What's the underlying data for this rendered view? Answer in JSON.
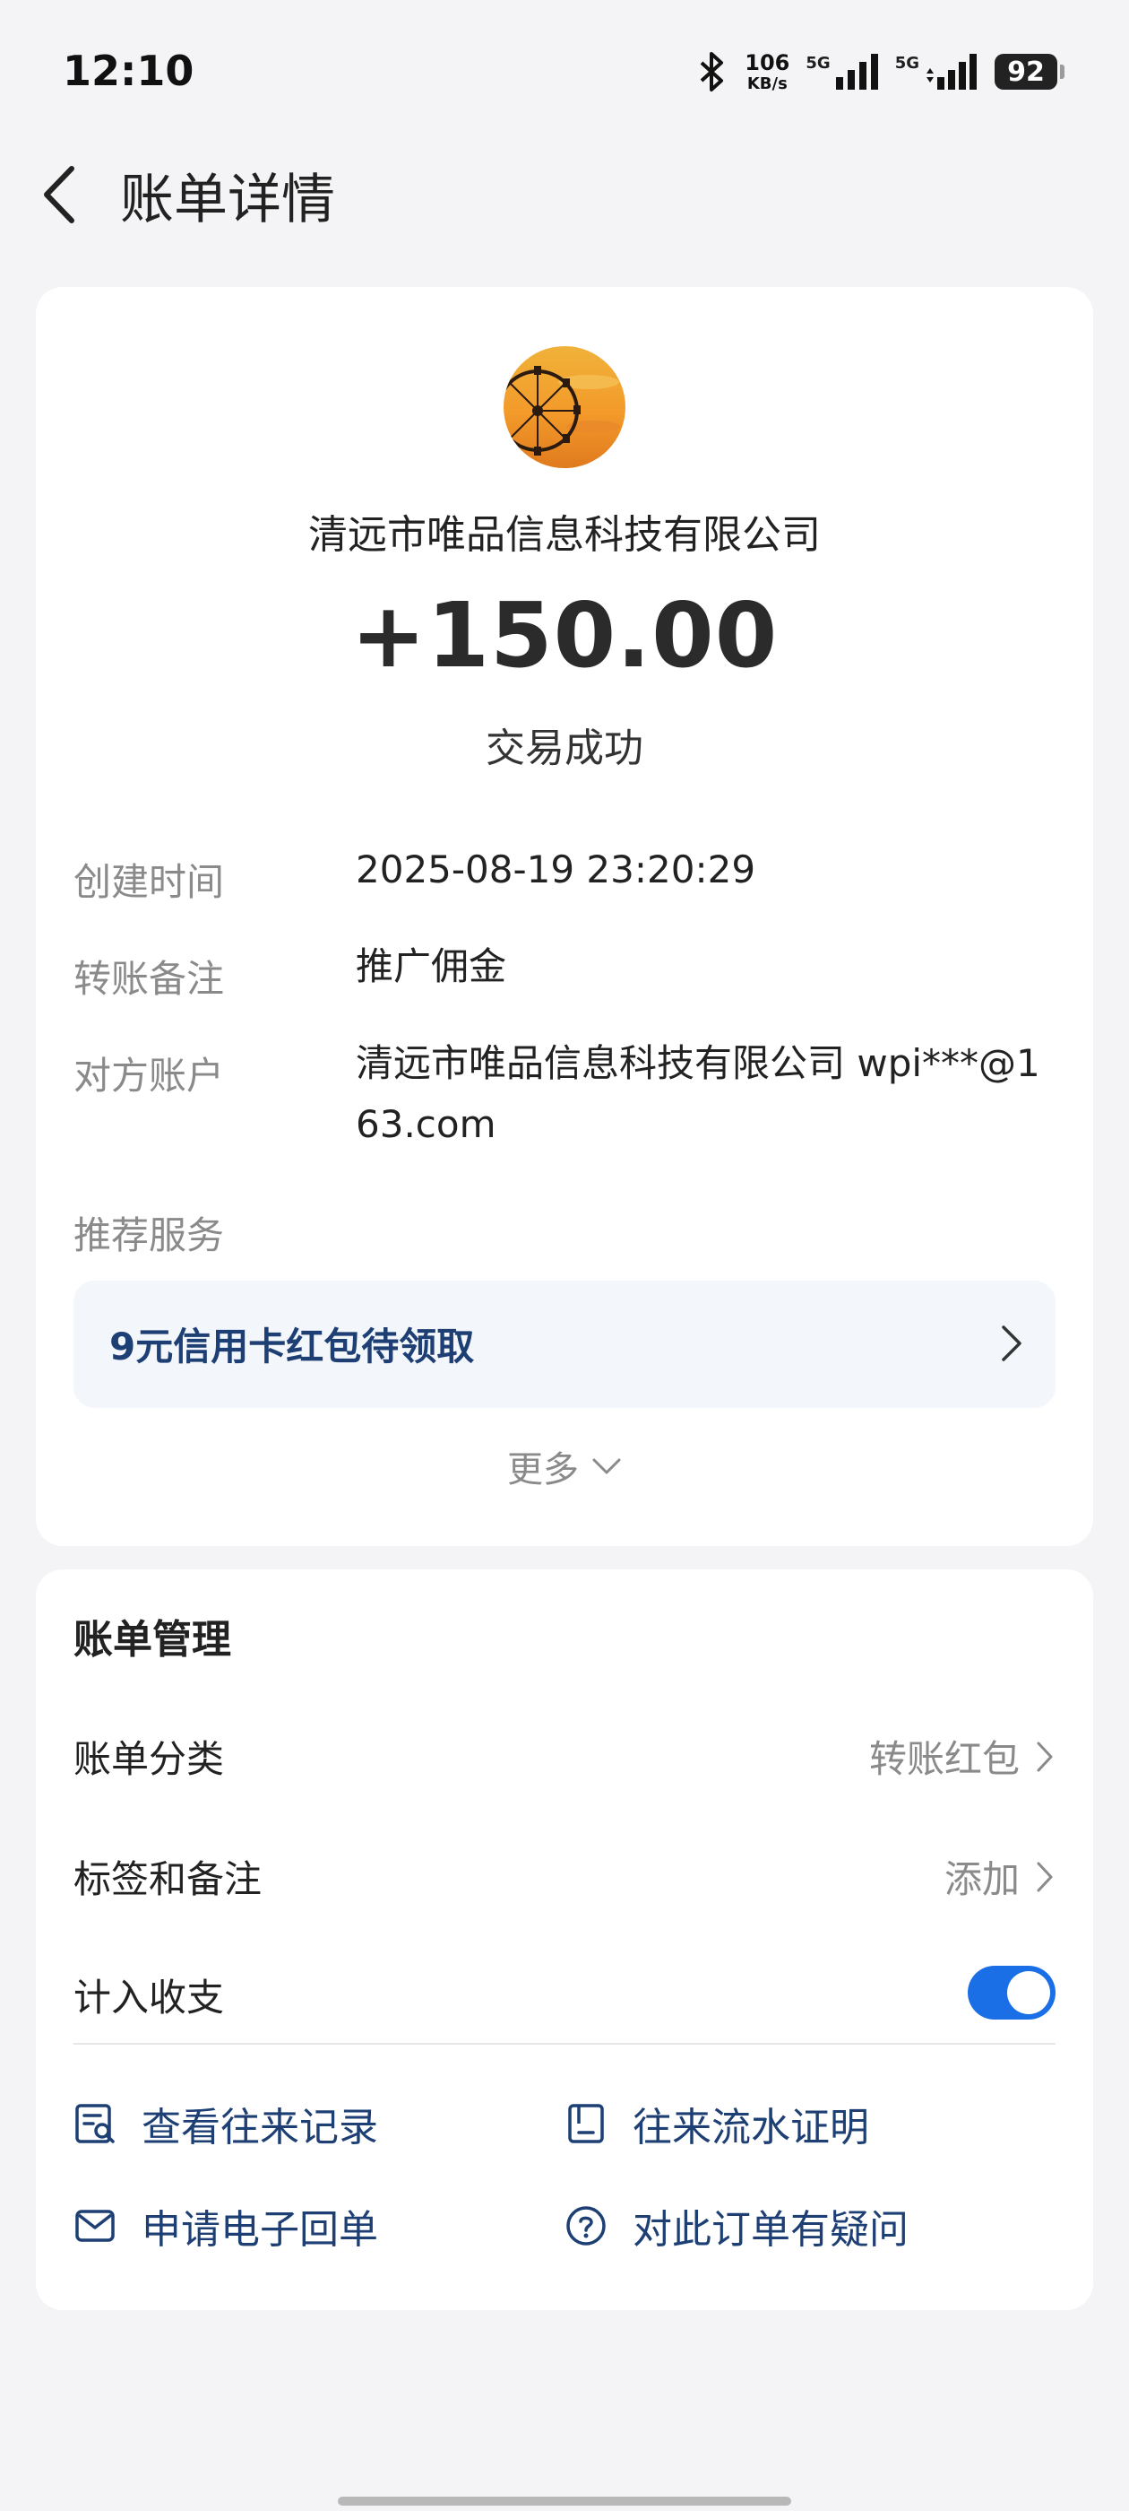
{
  "status_bar": {
    "time": "12:10",
    "net_speed_value": "106",
    "net_speed_unit": "KB/s",
    "sim1_label": "5G",
    "sim2_label": "5G",
    "battery": "92"
  },
  "header": {
    "title": "账单详情"
  },
  "transaction": {
    "payee": "清远市唯品信息科技有限公司",
    "amount": "+150.00",
    "status": "交易成功"
  },
  "details": [
    {
      "label": "创建时间",
      "value": "2025-08-19 23:20:29"
    },
    {
      "label": "转账备注",
      "value": "推广佣金"
    },
    {
      "label": "对方账户",
      "value": "清远市唯品信息科技有限公司 wpi***@1\n63.com"
    },
    {
      "label": "推荐服务",
      "value": ""
    }
  ],
  "promo": {
    "text": "9元信用卡红包待领取"
  },
  "more_label": "更多",
  "management": {
    "title": "账单管理",
    "category_label": "账单分类",
    "category_value": "转账红包",
    "tags_label": "标签和备注",
    "tags_value": "添加",
    "count_label": "计入收支",
    "count_enabled": true,
    "actions": {
      "history": "查看往来记录",
      "proof": "往来流水证明",
      "receipt": "申请电子回单",
      "question": "对此订单有疑问"
    }
  },
  "colors": {
    "accent": "#1a6fe6",
    "link": "#1d3f74",
    "muted": "#8a8a8a",
    "background": "#f4f4f6"
  },
  "icons": [
    "bluetooth-icon",
    "back-icon",
    "chevron-right-icon",
    "chevron-down-icon",
    "record-search-icon",
    "document-icon",
    "mail-icon",
    "question-icon"
  ]
}
